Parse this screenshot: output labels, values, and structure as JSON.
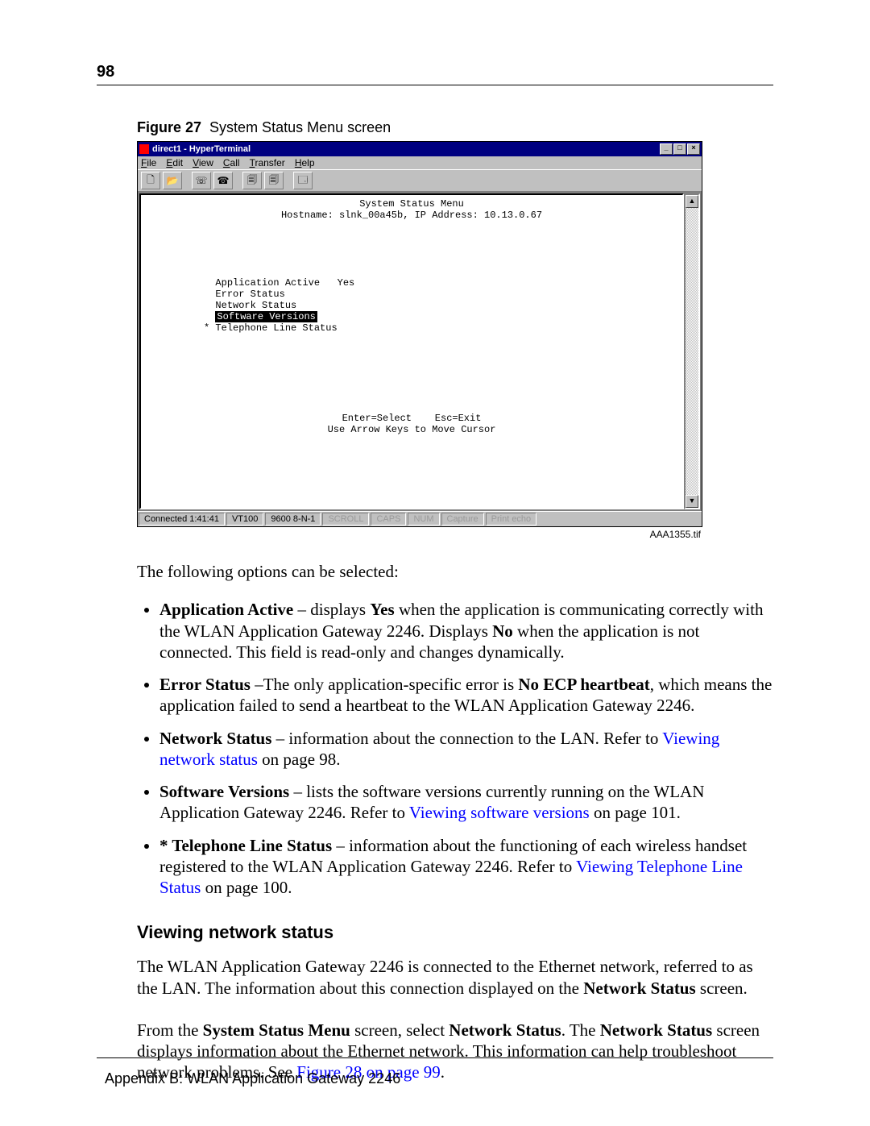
{
  "page_number": "98",
  "figure": {
    "label_bold": "Figure 27",
    "caption": "System Status Menu screen",
    "image_id": "AAA1355.tif"
  },
  "hyperterminal": {
    "title": "direct1 - HyperTerminal",
    "menus": {
      "file": "File",
      "edit": "Edit",
      "view": "View",
      "call": "Call",
      "transfer": "Transfer",
      "help": "Help"
    },
    "terminal": {
      "header1": "System Status Menu",
      "header2": "Hostname: slnk_00a45b, IP Address: 10.13.0.67",
      "row_app_active": "Application Active",
      "row_app_active_val": "Yes",
      "row_error": "Error Status",
      "row_network": "Network Status",
      "row_software_sel": "Software Versions",
      "row_phone": "* Telephone Line Status",
      "footer1": "Enter=Select    Esc=Exit",
      "footer2": "Use Arrow Keys to Move Cursor"
    },
    "status": {
      "connected": "Connected 1:41:41",
      "emulation": "VT100",
      "baud": "9600 8-N-1",
      "scroll": "SCROLL",
      "caps": "CAPS",
      "num": "NUM",
      "capture": "Capture",
      "echo": "Print echo"
    }
  },
  "intro": "The following options can be selected:",
  "options": {
    "app_active_1": "Application Active",
    "app_active_2": " – displays ",
    "app_active_yes": "Yes",
    "app_active_3": " when the application is communicating correctly with the WLAN Application Gateway 2246. Displays ",
    "app_active_no": "No",
    "app_active_4": " when the application is not connected. This field is read-only and changes dynamically.",
    "error_1": "Error Status",
    "error_2": " –The only application-specific error is ",
    "error_bold": "No ECP heartbeat",
    "error_3": ", which means the application failed to send a heartbeat to the WLAN Application Gateway 2246.",
    "net_1": "Network Status",
    "net_2": " – information about the connection to the LAN. Refer to ",
    "net_link": "Viewing network status",
    "net_3": " on page 98.",
    "sw_1": "Software Versions",
    "sw_2": " – lists the software versions currently running on the WLAN Application Gateway 2246. Refer to ",
    "sw_link": "Viewing software versions",
    "sw_3": " on page 101.",
    "tel_1": "* Telephone Line Status",
    "tel_2": " – information about the functioning of each wireless handset registered to the WLAN Application Gateway 2246. Refer to ",
    "tel_link": "Viewing Telephone Line Status",
    "tel_3": " on page 100."
  },
  "section_heading": "Viewing network status",
  "para1_a": "The WLAN Application Gateway 2246 is connected to the Ethernet network, referred to as the LAN. The information about this connection displayed on the ",
  "para1_bold": "Network Status",
  "para1_b": " screen.",
  "para2_a": "From the ",
  "para2_b1": "System Status Menu",
  "para2_c": " screen, select ",
  "para2_b2": "Network Status",
  "para2_d": ". The ",
  "para2_b3": "Network Status",
  "para2_e": " screen displays information about the Ethernet network. This information can help troubleshoot network problems. See ",
  "para2_link": "Figure 28 on page 99",
  "para2_f": ".",
  "footer": "Appendix B: WLAN Application Gateway 2246"
}
